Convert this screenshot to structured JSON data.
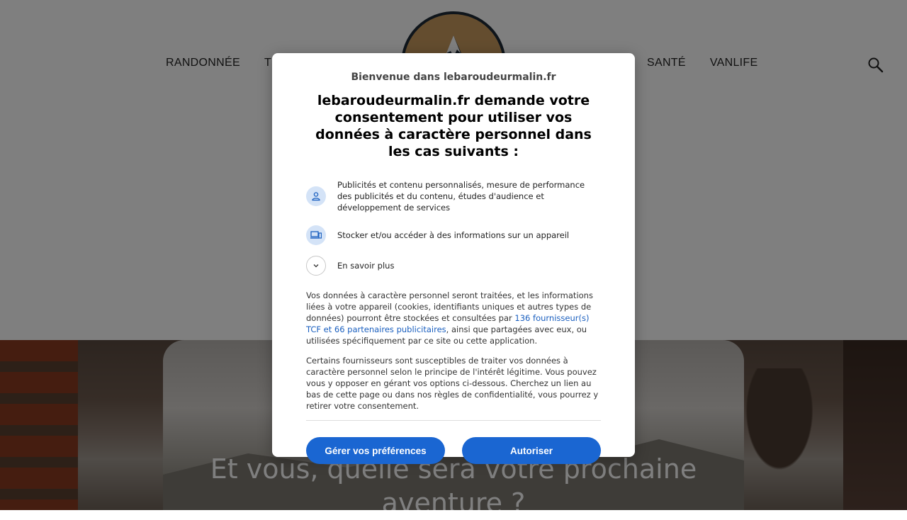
{
  "site": {
    "nav_left": [
      "RANDONNÉE",
      "TR"
    ],
    "nav_right": [
      "SANTÉ",
      "VANLIFE"
    ],
    "hero_title_line1": "Et vous, quelle sera votre prochaine",
    "hero_title_line2": "aventure ?"
  },
  "consent": {
    "welcome": "Bienvenue dans lebaroudeurmalin.fr",
    "headline": "lebaroudeurmalin.fr demande votre consentement pour utiliser vos données à caractère personnel dans les cas suivants :",
    "purposes": [
      {
        "icon": "person-icon",
        "text": "Publicités et contenu personnalisés, mesure de performance des publicités et du contenu, études d'audience et développement de services"
      },
      {
        "icon": "device-icon",
        "text": "Stocker et/ou accéder à des informations sur un appareil"
      },
      {
        "icon": "chevron-down-icon",
        "text": "En savoir plus"
      }
    ],
    "para1_before": "Vos données à caractère personnel seront traitées, et les informations liées à votre appareil (cookies, identifiants uniques et autres types de données) pourront être stockées et consultées par ",
    "para1_link": "136 fournisseur(s) TCF et 66 partenaires publicitaires",
    "para1_after": ", ainsi que partagées avec eux, ou utilisées spécifiquement par ce site ou cette application.",
    "para2": "Certains fournisseurs sont susceptibles de traiter vos données à caractère personnel selon le principe de l'intérêt légitime. Vous pouvez vous y opposer en gérant vos options ci-dessous. Cherchez un lien au bas de cette page ou dans nos règles de confidentialité, vous pourrez y retirer votre consentement.",
    "manage_button": "Gérer vos préférences",
    "accept_button": "Autoriser"
  },
  "colors": {
    "accent": "#1a66d2",
    "link": "#1a5fbf",
    "icon_bg": "#d4e3f7"
  }
}
